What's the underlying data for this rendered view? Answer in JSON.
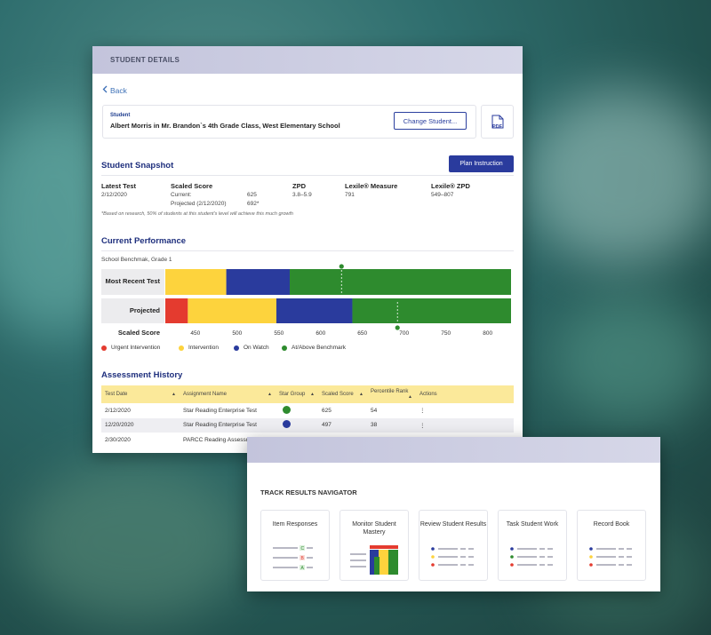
{
  "details_panel": {
    "header": "STUDENT DETAILS",
    "back": "Back",
    "student_label": "Student",
    "student_name": "Albert Morris in Mr. Brandon`s 4th Grade Class, West Elementary School",
    "change_button": "Change Student...",
    "pdf_label": "PDF",
    "snapshot": {
      "title": "Student Snapshot",
      "plan_button": "Plan Instruction",
      "latest_test_label": "Latest Test",
      "latest_test_value": "2/12/2020",
      "scaled_score_label": "Scaled Score",
      "current_label": "Current:",
      "current_value": "625",
      "projected_label": "Projected (2/12/2020)",
      "projected_value": "692*",
      "zpd_label": "ZPD",
      "zpd_value": "3.8–5.9",
      "lexile_label": "Lexile® Measure",
      "lexile_value": "791",
      "lexile_zpd_label": "Lexile® ZPD",
      "lexile_zpd_value": "549–807",
      "footnote": "*Based on research, 50% of students at this student's level will achieve this much growth"
    },
    "performance": {
      "title": "Current Performance",
      "benchmark": "School Benchmak, Grade 1",
      "row1_label": "Most Recent Test",
      "row2_label": "Projected",
      "axis_label": "Scaled Score",
      "legend": [
        "Urgent Intervention",
        "Intervention",
        "On Watch",
        "At/Above Benchmark"
      ]
    },
    "history": {
      "title": "Assessment History",
      "columns": [
        "Test Date",
        "Assignment Name",
        "Star Group",
        "Scaled Score",
        "Percentile Rank",
        "Actions"
      ],
      "rows": [
        {
          "date": "2/12/2020",
          "name": "Star Reading Enterprise Test",
          "group_color": "#2e8b2e",
          "score": "625",
          "rank": "54"
        },
        {
          "date": "12/20/2020",
          "name": "Star Reading Enterprise Test",
          "group_color": "#2a3b9d",
          "score": "497",
          "rank": "38"
        },
        {
          "date": "2/30/2020",
          "name": "PARCC Reading Assessment",
          "group_color": "",
          "score": "",
          "rank": ""
        }
      ]
    }
  },
  "navigator": {
    "title": "TRACK RESULTS NAVIGATOR",
    "tiles": [
      {
        "label": "Item Responses"
      },
      {
        "label": "Monitor Student Mastery"
      },
      {
        "label": "Review Student Results"
      },
      {
        "label": "Task Student Work"
      },
      {
        "label": "Record Book"
      }
    ]
  },
  "chart_data": {
    "type": "bar",
    "xlabel": "Scaled Score",
    "ticks": [
      450,
      500,
      550,
      600,
      650,
      700,
      750,
      800
    ],
    "xlim": [
      414,
      828
    ],
    "categories": [
      "Most Recent Test",
      "Projected"
    ],
    "bands": {
      "Most Recent Test": [
        {
          "level": "Intervention",
          "from": 414,
          "to": 487,
          "color": "#fdd33d"
        },
        {
          "level": "On Watch",
          "from": 487,
          "to": 563,
          "color": "#2a3b9d"
        },
        {
          "level": "At/Above Benchmark",
          "from": 563,
          "to": 828,
          "color": "#2e8b2e"
        }
      ],
      "Projected": [
        {
          "level": "Urgent Intervention",
          "from": 414,
          "to": 441,
          "color": "#e43b2f"
        },
        {
          "level": "Intervention",
          "from": 441,
          "to": 547,
          "color": "#fdd33d"
        },
        {
          "level": "On Watch",
          "from": 547,
          "to": 638,
          "color": "#2a3b9d"
        },
        {
          "level": "At/Above Benchmark",
          "from": 638,
          "to": 828,
          "color": "#2e8b2e"
        }
      ]
    },
    "markers": {
      "Most Recent Test": 625,
      "Projected": 692
    }
  },
  "colors": {
    "accent": "#2a3b9d",
    "title": "#1e2f7d",
    "table_header": "#fbe99a",
    "urgent": "#e43b2f",
    "intervention": "#fdd33d",
    "on_watch": "#2a3b9d",
    "benchmark": "#2e8b2e"
  }
}
